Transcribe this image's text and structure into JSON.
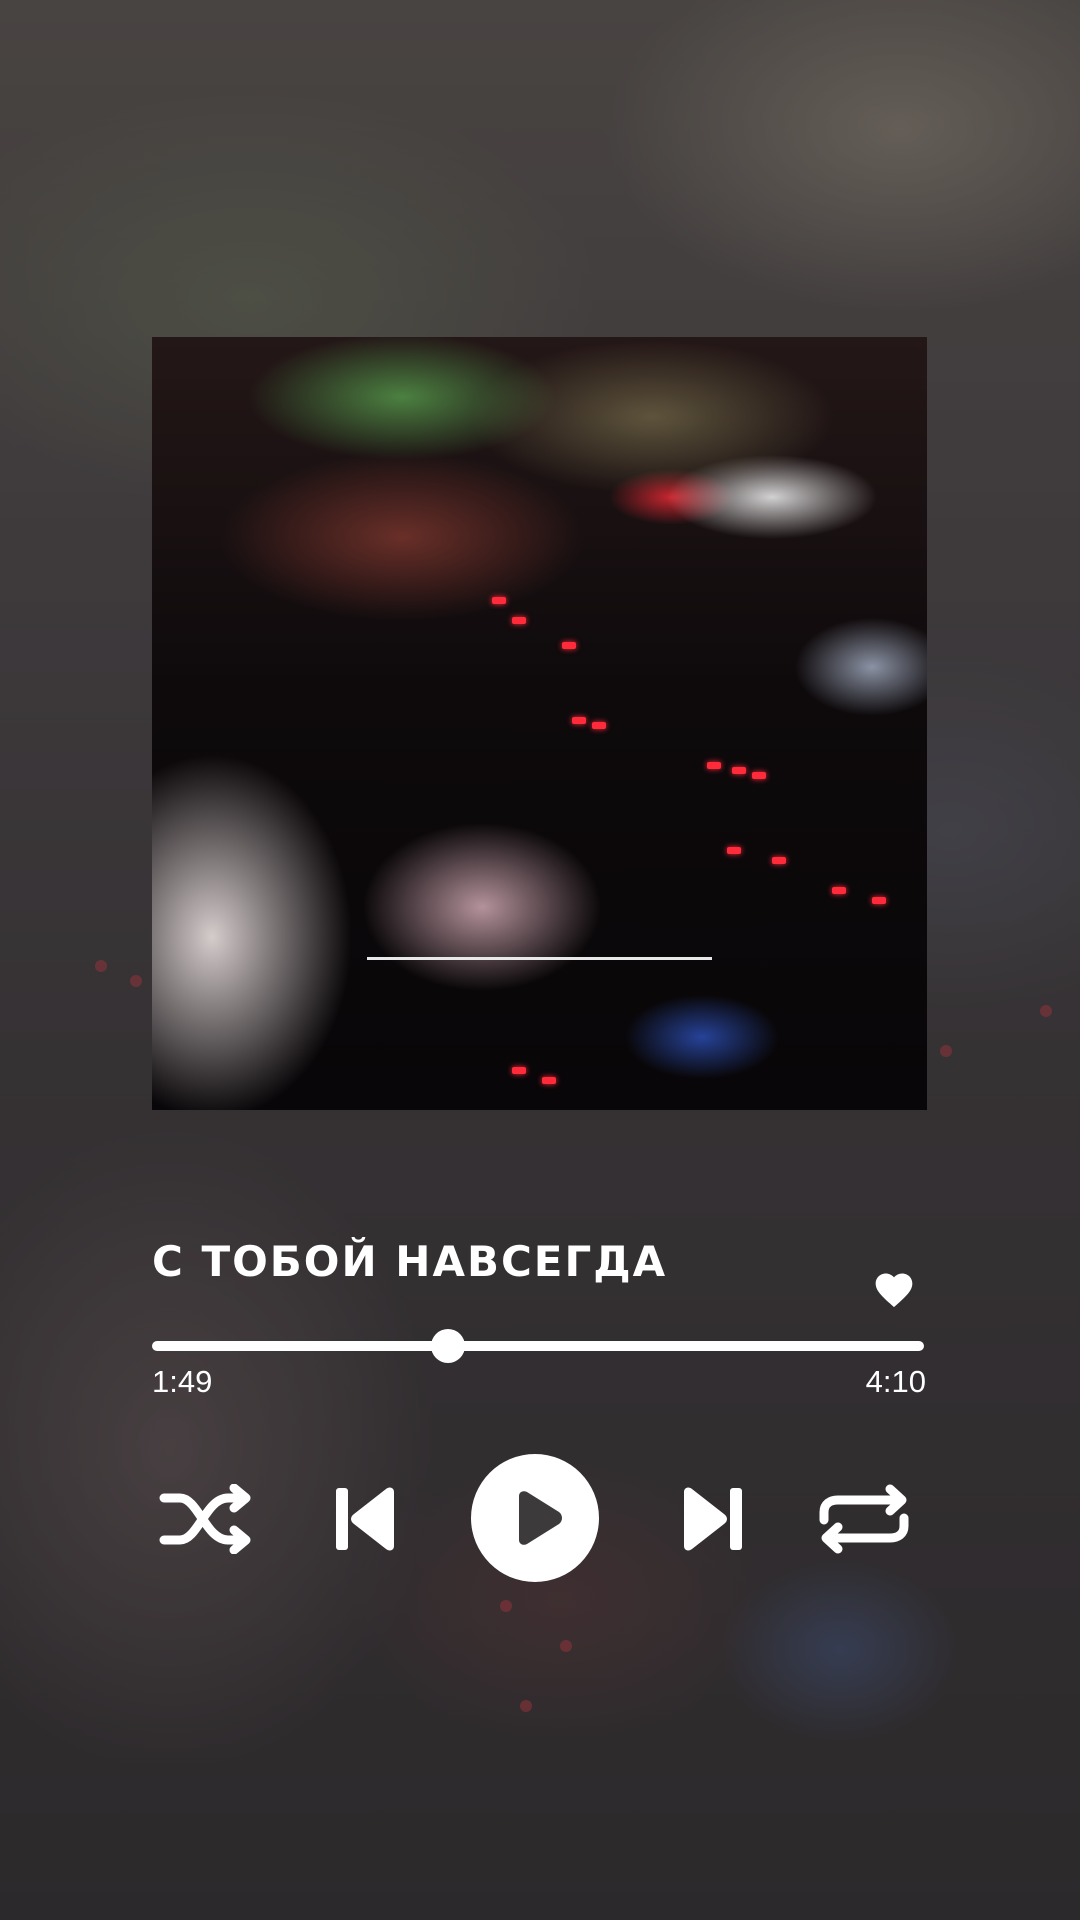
{
  "track": {
    "title": "С ТОБОЙ НАВСЕГДА",
    "current_time": "1:49",
    "total_time": "4:10",
    "progress_fraction": 0.384
  },
  "controls": {
    "shuffle_icon": "shuffle-icon",
    "previous_icon": "skip-previous-icon",
    "play_icon": "play-icon",
    "next_icon": "skip-next-icon",
    "repeat_icon": "repeat-icon",
    "like_icon": "heart-icon"
  },
  "colors": {
    "foreground": "#ffffff",
    "background": "#3d3a3c"
  }
}
